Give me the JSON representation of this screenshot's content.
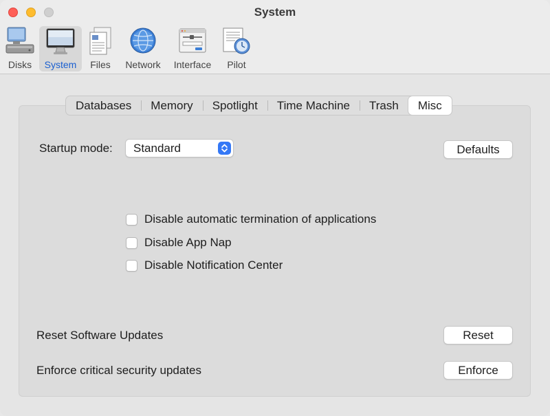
{
  "window": {
    "title": "System"
  },
  "toolbar": {
    "items": [
      {
        "label": "Disks",
        "icon": "disks-icon",
        "selected": false
      },
      {
        "label": "System",
        "icon": "monitor-icon",
        "selected": true
      },
      {
        "label": "Files",
        "icon": "files-icon",
        "selected": false
      },
      {
        "label": "Network",
        "icon": "network-globe-icon",
        "selected": false
      },
      {
        "label": "Interface",
        "icon": "interface-icon",
        "selected": false
      },
      {
        "label": "Pilot",
        "icon": "pilot-icon",
        "selected": false
      }
    ]
  },
  "tabs": [
    {
      "label": "Databases",
      "active": false
    },
    {
      "label": "Memory",
      "active": false
    },
    {
      "label": "Spotlight",
      "active": false
    },
    {
      "label": "Time Machine",
      "active": false
    },
    {
      "label": "Trash",
      "active": false
    },
    {
      "label": "Misc",
      "active": true
    }
  ],
  "misc": {
    "startup_label": "Startup mode:",
    "startup_value": "Standard",
    "defaults_button": "Defaults",
    "checkboxes": [
      {
        "label": "Disable automatic termination of applications",
        "checked": false
      },
      {
        "label": "Disable App Nap",
        "checked": false
      },
      {
        "label": "Disable Notification Center",
        "checked": false
      }
    ],
    "reset_label": "Reset Software Updates",
    "reset_button": "Reset",
    "enforce_label": "Enforce critical security updates",
    "enforce_button": "Enforce"
  },
  "colors": {
    "accent": "#3478f6",
    "selected_label": "#1a5fd0",
    "close": "#fe5f57",
    "minimize": "#febc2e"
  }
}
